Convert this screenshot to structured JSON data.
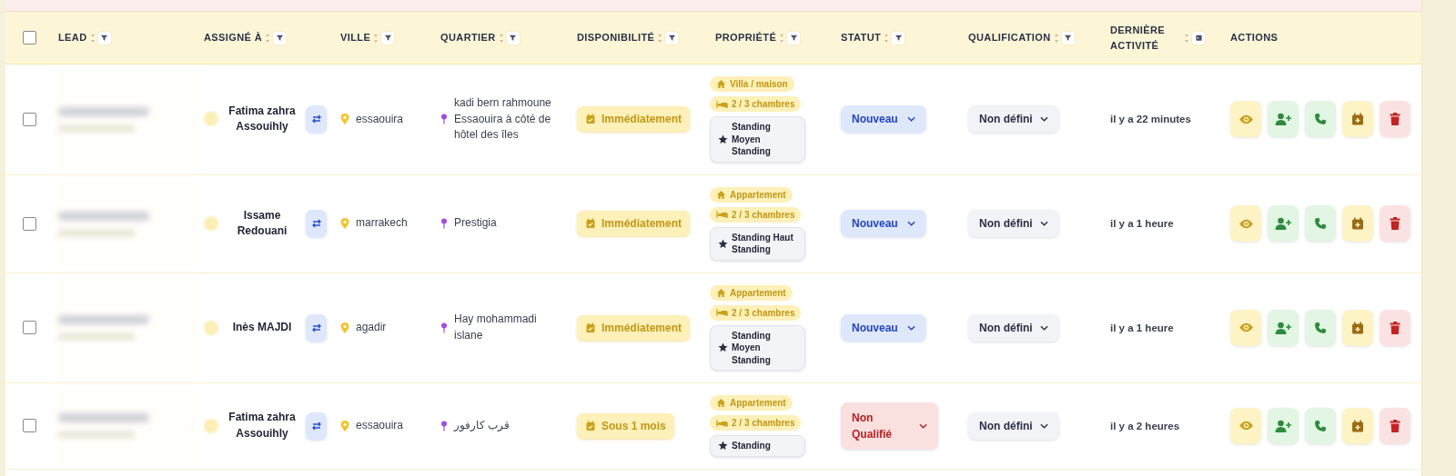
{
  "table": {
    "select_all_checked": false,
    "columns": [
      {
        "label": "LEAD",
        "kind": "filter"
      },
      {
        "label": "ASSIGNÉ À",
        "kind": "filter"
      },
      {
        "label": "VILLE",
        "kind": "filter"
      },
      {
        "label": "QUARTIER",
        "kind": "filter"
      },
      {
        "label": "DISPONIBILITÉ",
        "kind": "filter"
      },
      {
        "label": "PROPRIÉTÉ",
        "kind": "filter"
      },
      {
        "label": "STATUT",
        "kind": "filter"
      },
      {
        "label": "QUALIFICATION",
        "kind": "filter"
      },
      {
        "label": "DERNIÈRE ACTIVITÉ",
        "kind": "date"
      },
      {
        "label": "ACTIONS",
        "kind": "plain"
      }
    ],
    "rows": [
      {
        "checked": false,
        "assignee": "Fatima zahra Assouihly",
        "city": "essaouira",
        "district": "kadi bern rahmoune Essaouira à côté de hôtel des îles",
        "availability": "Immédiatement",
        "property_type": "Villa / maison",
        "rooms": "2 / 3 chambres",
        "standing": "Standing Moyen Standing",
        "status": {
          "label": "Nouveau",
          "kind": "new"
        },
        "qualification": "Non défini",
        "last_activity": "il y a 22 minutes"
      },
      {
        "checked": false,
        "assignee": "Issame Redouani",
        "city": "marrakech",
        "district": "Prestigia",
        "availability": "Immédiatement",
        "property_type": "Appartement",
        "rooms": "2 / 3 chambres",
        "standing": "Standing Haut Standing",
        "status": {
          "label": "Nouveau",
          "kind": "new"
        },
        "qualification": "Non défini",
        "last_activity": "il y a 1 heure"
      },
      {
        "checked": false,
        "assignee": "Inès MAJDI",
        "city": "agadir",
        "district": "Hay mohammadi islane",
        "availability": "Immédiatement",
        "property_type": "Appartement",
        "rooms": "2 / 3 chambres",
        "standing": "Standing Moyen Standing",
        "status": {
          "label": "Nouveau",
          "kind": "new"
        },
        "qualification": "Non défini",
        "last_activity": "il y a 1 heure"
      },
      {
        "checked": false,
        "assignee": "Fatima zahra Assouihly",
        "city": "essaouira",
        "district": "قرب كارفور",
        "availability": "Sous 1 mois",
        "property_type": "Appartement",
        "rooms": "2 / 3 chambres",
        "standing": "Standing",
        "status": {
          "label": "Non Qualifié",
          "kind": "rejected"
        },
        "qualification": "Non défini",
        "last_activity": "il y a 2 heures"
      }
    ]
  }
}
